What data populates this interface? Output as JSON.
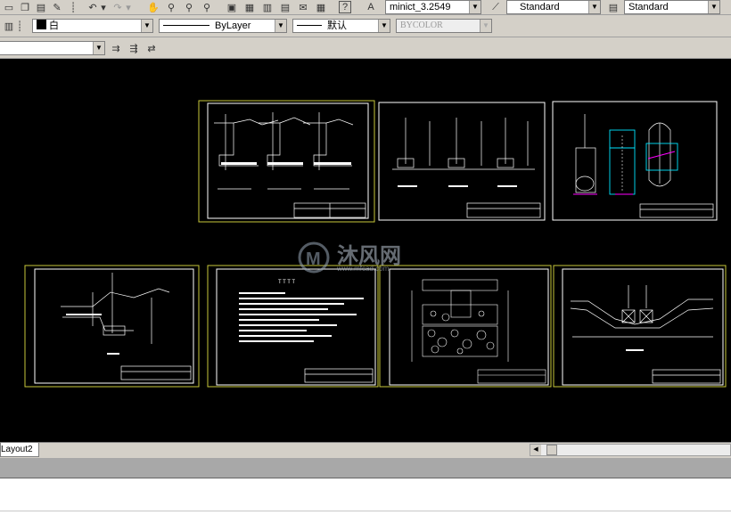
{
  "toolbar_top": {
    "text_style_value": "minict_3.2549",
    "dim_style_value": "Standard",
    "table_style_value": "Standard"
  },
  "toolbar_props": {
    "color_value": "白",
    "linetype_value": "ByLayer",
    "lineweight_value": "默认",
    "plotstyle_value": "BYCOLOR"
  },
  "layout_tabs": [
    "Layout2"
  ],
  "watermark": {
    "brand_cn": "沐风网",
    "url": "www.mfcad.com"
  },
  "sheets": [
    {
      "name": "sheet-1",
      "content": "retaining-wall-sections"
    },
    {
      "name": "sheet-2",
      "content": "column-details"
    },
    {
      "name": "sheet-3",
      "content": "pipe-well-detail"
    },
    {
      "name": "sheet-4",
      "content": "slope-section"
    },
    {
      "name": "sheet-5",
      "content": "design-notes",
      "heading": "T T T T"
    },
    {
      "name": "sheet-6",
      "content": "rubble-masonry-detail"
    },
    {
      "name": "sheet-7",
      "content": "culvert-section"
    }
  ],
  "colors": {
    "model_bg": "#000000",
    "sheet_border": "#c8c83a",
    "drawing_line": "#ffffff",
    "accent_cyan": "#00e5ff",
    "accent_magenta": "#ff00ff",
    "toolbar_bg": "#d4d0c8"
  }
}
